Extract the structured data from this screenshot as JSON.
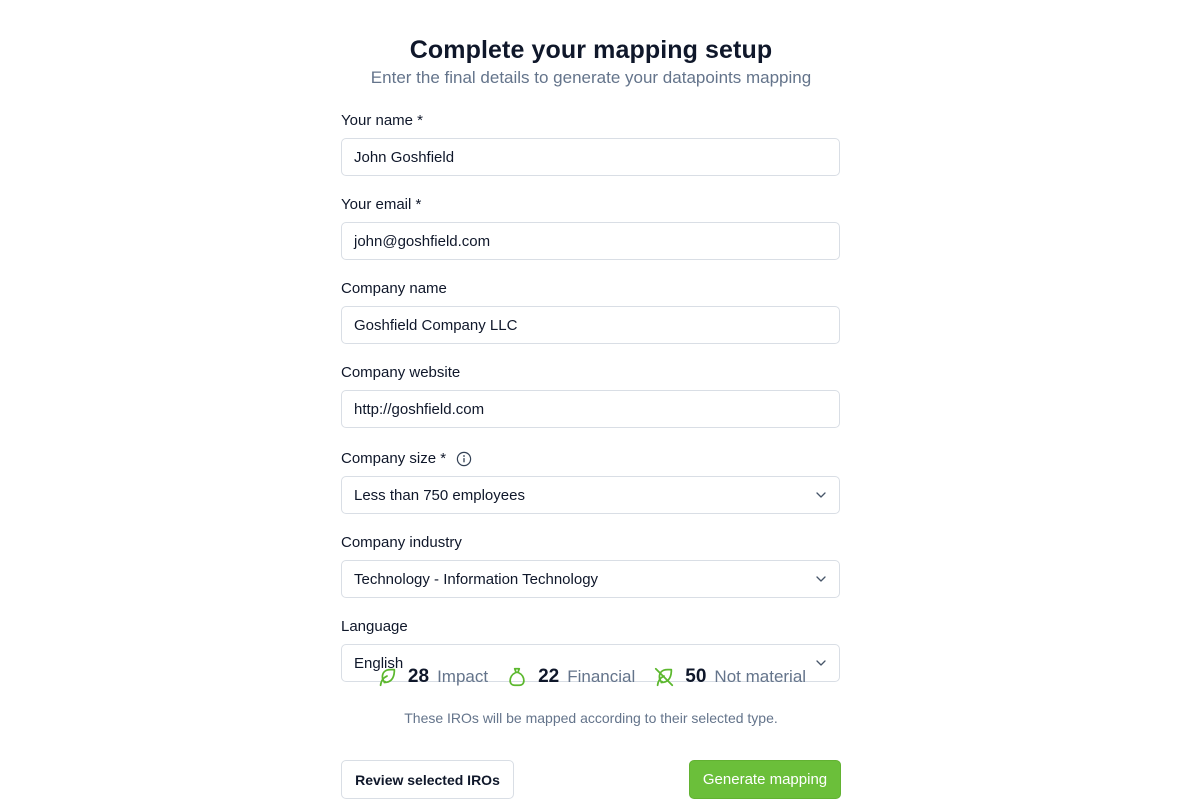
{
  "header": {
    "title": "Complete your mapping setup",
    "subtitle": "Enter the final details to generate your datapoints mapping"
  },
  "form": {
    "name": {
      "label": "Your name *",
      "value": "John Goshfield"
    },
    "email": {
      "label": "Your email *",
      "value": "john@goshfield.com"
    },
    "company_name": {
      "label": "Company name",
      "value": "Goshfield Company LLC"
    },
    "company_website": {
      "label": "Company website",
      "value": "http://goshfield.com"
    },
    "company_size": {
      "label": "Company size *",
      "value": "Less than 750 employees",
      "info_icon": "info-circle-icon"
    },
    "company_industry": {
      "label": "Company industry",
      "value": "Technology - Information Technology"
    },
    "language": {
      "label": "Language",
      "value": "English"
    }
  },
  "stats": [
    {
      "icon": "leaf-icon",
      "count": "28",
      "label": "Impact"
    },
    {
      "icon": "money-bag-icon",
      "count": "22",
      "label": "Financial"
    },
    {
      "icon": "leaf-off-icon",
      "count": "50",
      "label": "Not material"
    }
  ],
  "note": "These IROs will be mapped according to their selected type.",
  "actions": {
    "review_label": "Review selected IROs",
    "generate_label": "Generate mapping"
  },
  "colors": {
    "accent": "#6bbf3a",
    "icon_green": "#5cb82e",
    "text": "#0f172a",
    "muted": "#64748b",
    "border": "#d9dee5"
  }
}
